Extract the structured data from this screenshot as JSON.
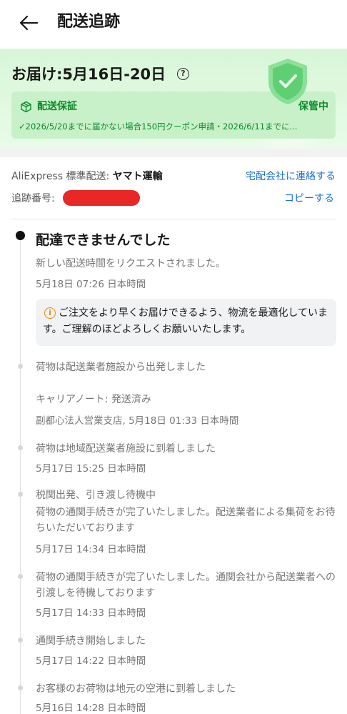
{
  "header": {
    "title": "配送追跡"
  },
  "delivery": {
    "eta": "お届け:5月16日-20日",
    "info_icon": "?",
    "guarantee": {
      "title": "配送保証",
      "status": "保管中",
      "detail": "✓2026/5/20までに届かない場合150円クーポン申請・2026/6/11までに..."
    }
  },
  "carrier": {
    "prefix": "AliExpress 標準配送: ",
    "name": "ヤマト運輸",
    "contact_label": "宅配会社に連絡する",
    "tracking_label": "追跡番号:",
    "copy_label": "コピーする"
  },
  "timeline": {
    "current_status": "配達できませんでした",
    "events": [
      {
        "text": "新しい配送時間をリクエストされました。",
        "time": "5月18日 07:26 日本時間"
      },
      {
        "text": "荷物は配送業者施設から出発しました"
      },
      {
        "text": "キャリアノート: 発送済み",
        "time": "副都心法人営業支店, 5月18日 01:33 日本時間"
      },
      {
        "text": "荷物は地域配送業者施設に到着しました",
        "time": "5月17日 15:25 日本時間"
      },
      {
        "text": "税関出発、引き渡し待機中",
        "text2": "荷物の通関手続きが完了いたしました。配送業者による集荷をお待ちいただいております",
        "time": "5月17日 14:34 日本時間"
      },
      {
        "text": "荷物の通関手続きが完了いたしました。通関会社から配送業者への引渡しを待機しております",
        "time": "5月17日 14:33 日本時間"
      },
      {
        "text": "通関手続き開始しました",
        "time": "5月17日 14:22 日本時間"
      },
      {
        "text": "お客様のお荷物は地元の空港に到着しました",
        "time": "5月16日 14:28 日本時間"
      }
    ],
    "notice": "ご注文をより早くお届けできるよう、物流を最適化しています。ご理解のほどよろしくお願いいたします。",
    "notice_icon": "i"
  },
  "colors": {
    "accent_link": "#1a6fd6",
    "guarantee_green": "#0a8a2a",
    "notice_orange": "#f08a00",
    "redaction": "#e82727"
  }
}
